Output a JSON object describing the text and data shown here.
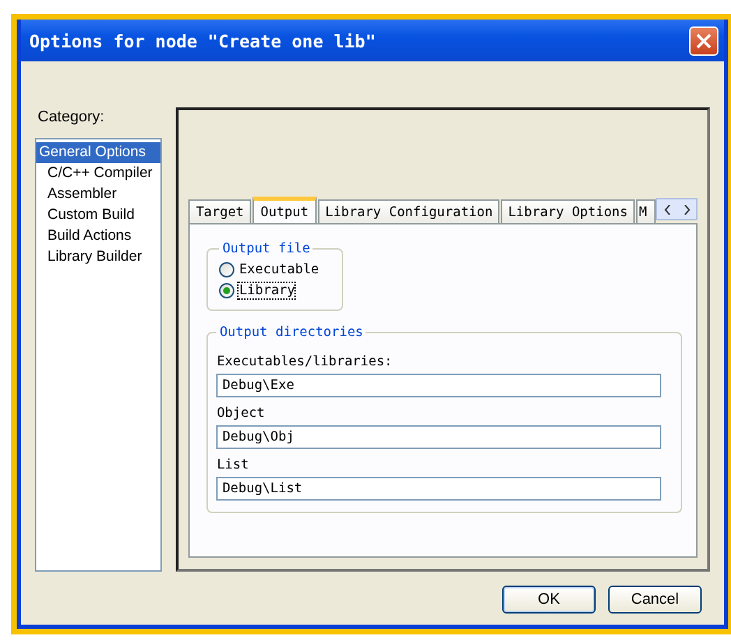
{
  "window": {
    "title": "Options for node \"Create one lib\""
  },
  "category": {
    "label": "Category:",
    "items": [
      {
        "label": "General Options",
        "selected": true
      },
      {
        "label": "C/C++ Compiler",
        "selected": false
      },
      {
        "label": "Assembler",
        "selected": false
      },
      {
        "label": "Custom Build",
        "selected": false
      },
      {
        "label": "Build Actions",
        "selected": false
      },
      {
        "label": "Library Builder",
        "selected": false
      }
    ]
  },
  "tabs": [
    {
      "label": "Target",
      "selected": false
    },
    {
      "label": "Output",
      "selected": true
    },
    {
      "label": "Library Configuration",
      "selected": false
    },
    {
      "label": "Library Options",
      "selected": false
    },
    {
      "label": "M",
      "selected": false
    }
  ],
  "output_file": {
    "title": "Output file",
    "options": [
      {
        "label": "Executable",
        "selected": false
      },
      {
        "label": "Library",
        "selected": true
      }
    ]
  },
  "output_directories": {
    "title": "Output directories",
    "fields": [
      {
        "label": "Executables/libraries:",
        "value": "Debug\\Exe"
      },
      {
        "label": "Object",
        "value": "Debug\\Obj"
      },
      {
        "label": "List",
        "value": "Debug\\List"
      }
    ]
  },
  "buttons": [
    "OK",
    "Cancel"
  ]
}
